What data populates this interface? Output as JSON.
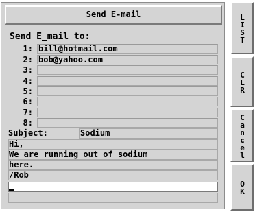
{
  "dialog": {
    "title": "Send E-mail",
    "to_label": "Send E_mail to:",
    "recipients": [
      {
        "num": "1:",
        "value": "bill@hotmail.com"
      },
      {
        "num": "2:",
        "value": "bob@yahoo.com"
      },
      {
        "num": "3:",
        "value": ""
      },
      {
        "num": "4:",
        "value": ""
      },
      {
        "num": "5:",
        "value": ""
      },
      {
        "num": "6:",
        "value": ""
      },
      {
        "num": "7:",
        "value": ""
      },
      {
        "num": "8:",
        "value": ""
      }
    ],
    "subject_label": "Subject:",
    "subject_value": "Sodium",
    "body_lines": [
      "Hi,",
      "We are running out of sodium",
      "here.",
      "/Rob",
      "",
      ""
    ]
  },
  "buttons": {
    "list": "LIST",
    "clear": "CLR",
    "cancel": "Cancel",
    "ok": "OK"
  }
}
